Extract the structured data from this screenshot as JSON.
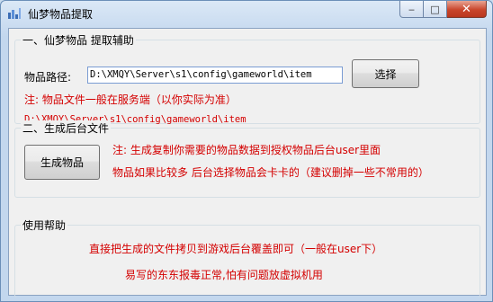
{
  "window": {
    "title": "仙梦物品提取",
    "min_label": "‒",
    "max_label": "□",
    "close_label": "✕"
  },
  "group1": {
    "label": "一、仙梦物品 提取辅助",
    "path_label": "物品路径:",
    "path_value": "D:\\XMQY\\Server\\s1\\config\\gameworld\\item",
    "select_button": "选择",
    "note": "注: 物品文件一般在服务端（以你实际为准）",
    "path_display": "D:\\XMQY\\Server\\s1\\config\\gameworld\\item"
  },
  "group2": {
    "label": "二、生成后台文件",
    "generate_button": "生成物品",
    "note_line1": "注: 生成复制你需要的物品数据到授权物品后台user里面",
    "note_line2": "物品如果比较多 后台选择物品会卡卡的（建议删掉一些不常用的）"
  },
  "help": {
    "label": "使用帮助",
    "line1": "直接把生成的文件拷贝到游戏后台覆盖即可（一般在user下）",
    "line2": "易写的东东报毒正常,怕有问题放虚拟机用"
  },
  "colors": {
    "note_red": "#d40000"
  }
}
